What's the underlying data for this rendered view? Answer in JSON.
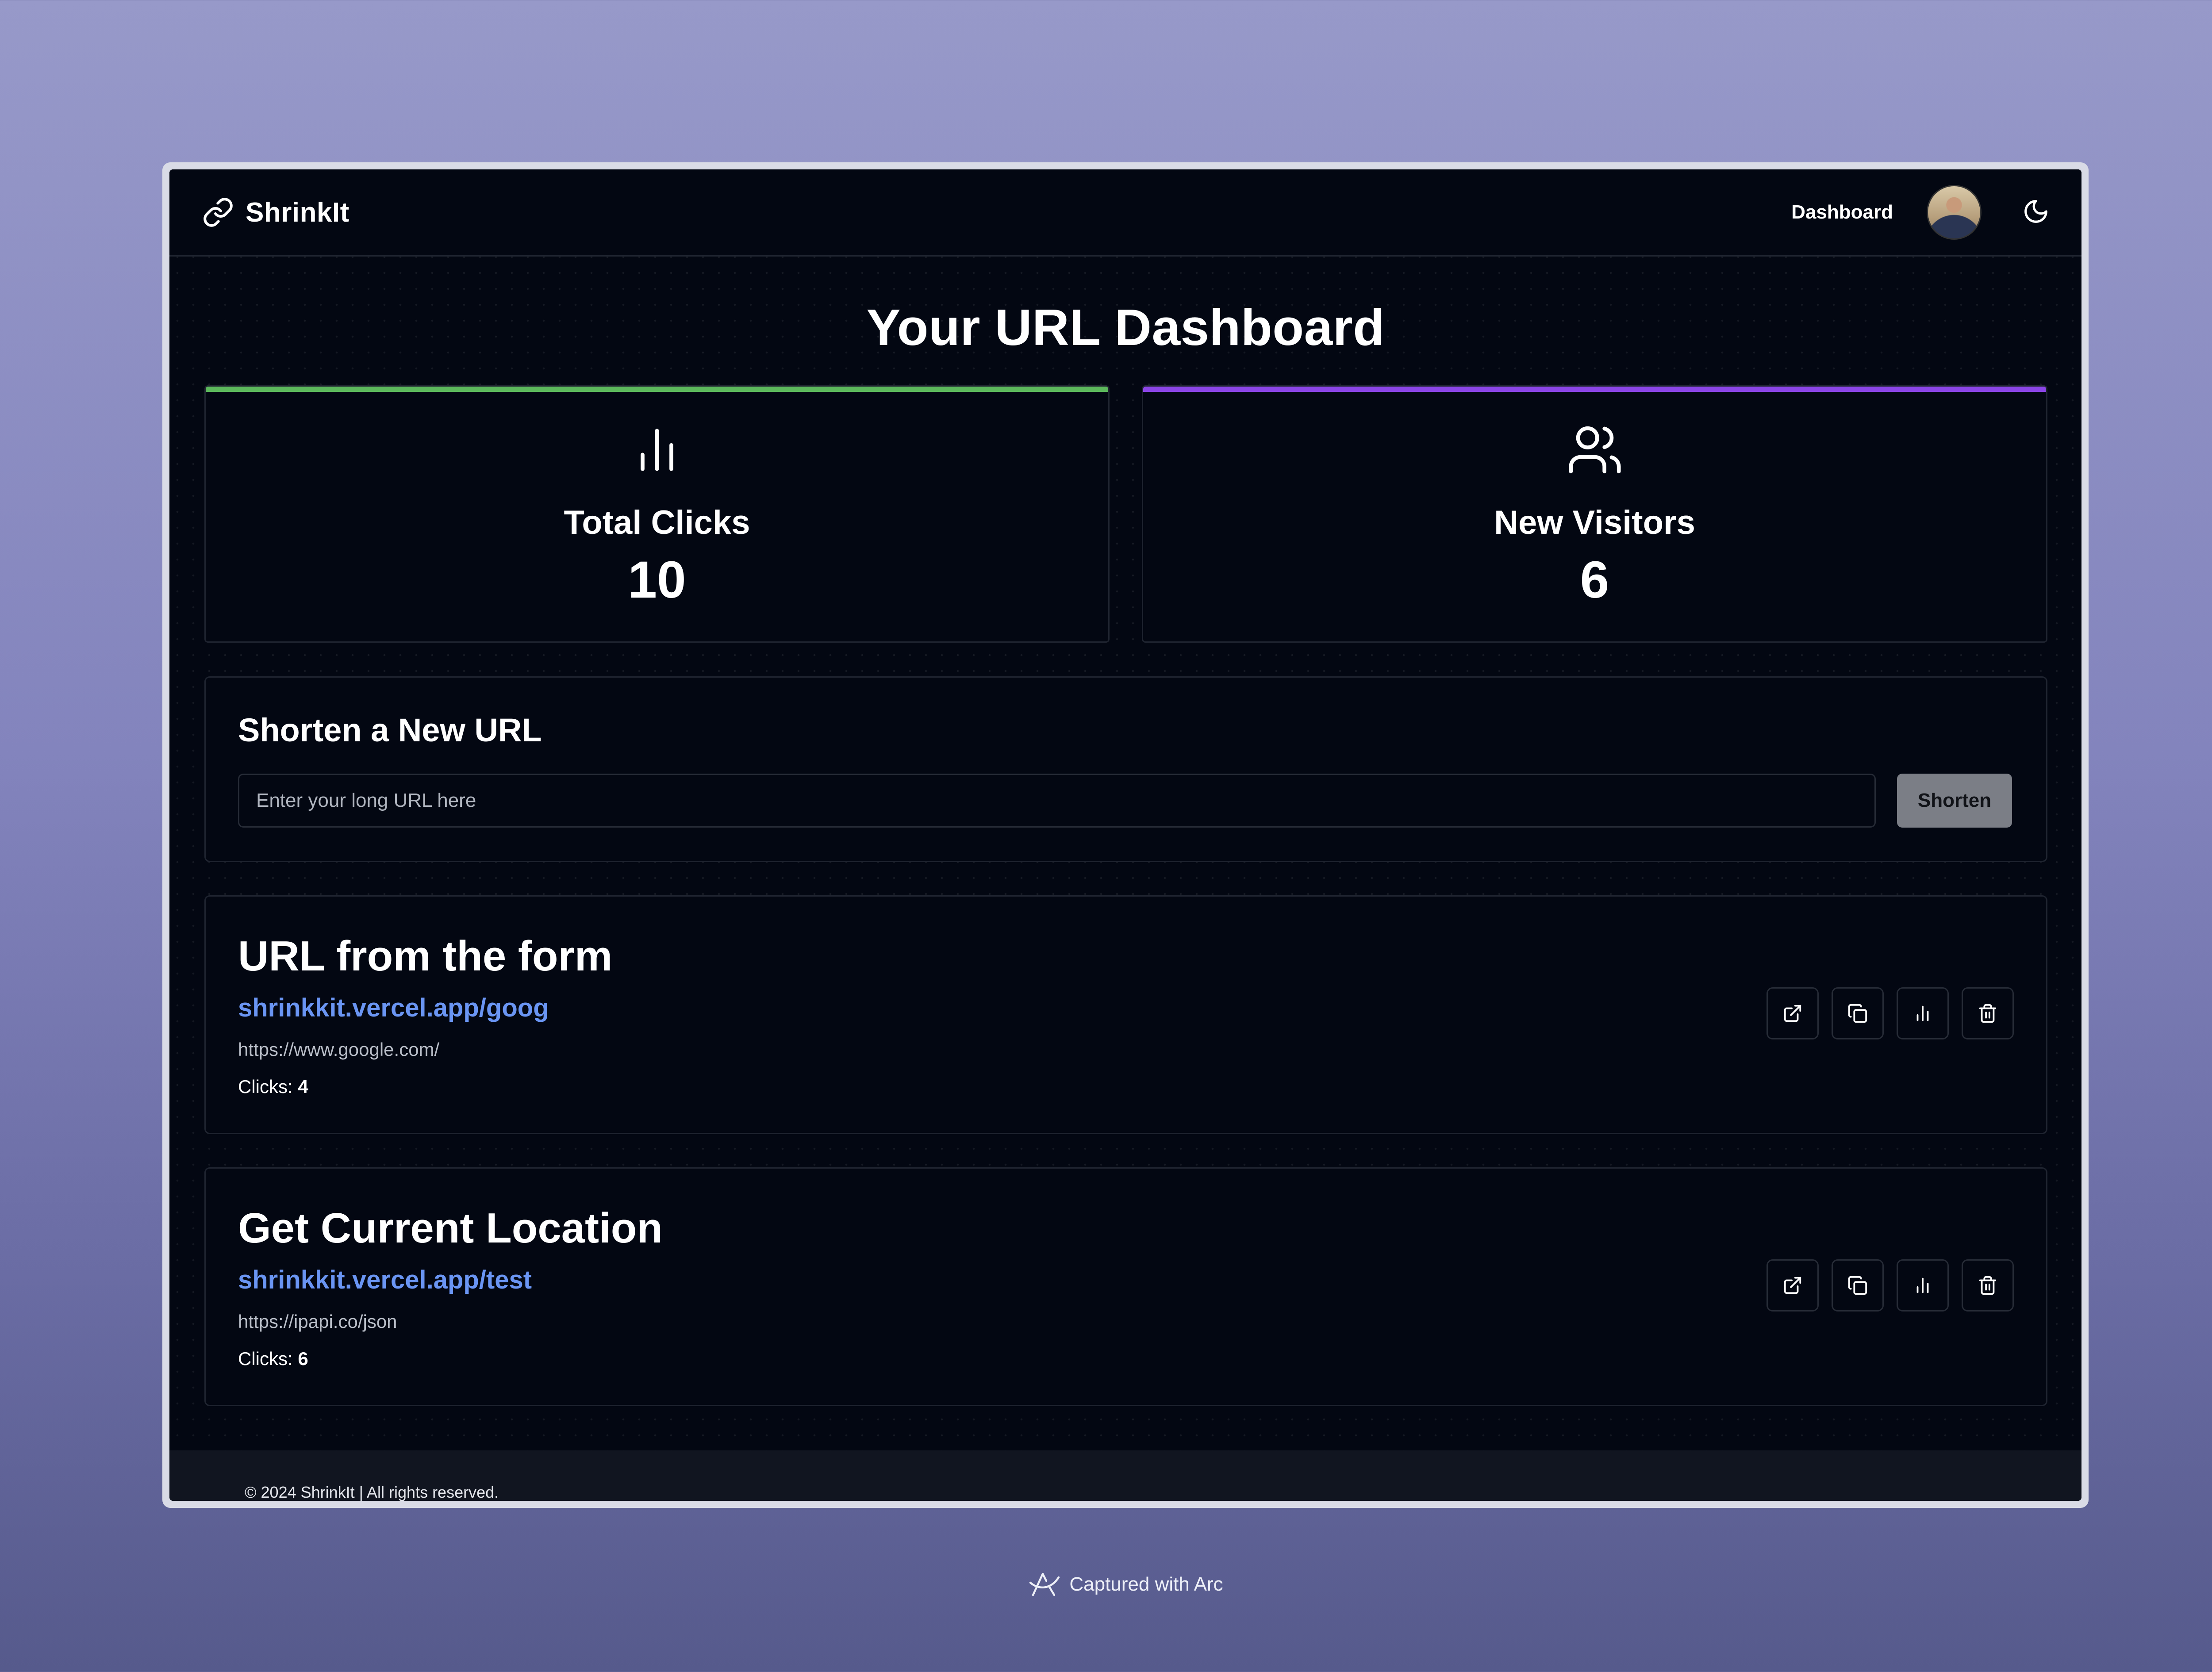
{
  "app": {
    "name": "ShrinkIt"
  },
  "nav": {
    "dashboard_label": "Dashboard"
  },
  "page": {
    "title": "Your URL Dashboard"
  },
  "stats": {
    "total_clicks": {
      "label": "Total Clicks",
      "value": "10",
      "accent": "#4caf50"
    },
    "new_visitors": {
      "label": "New Visitors",
      "value": "6",
      "accent": "#8b45e6"
    }
  },
  "shorten": {
    "title": "Shorten a New URL",
    "placeholder": "Enter your long URL here",
    "value": "",
    "button_label": "Shorten"
  },
  "urls": [
    {
      "title": "URL from the form",
      "short_url": "shrinkkit.vercel.app/goog",
      "original_url": "https://www.google.com/",
      "clicks_label": "Clicks:",
      "clicks": "4"
    },
    {
      "title": "Get Current Location",
      "short_url": "shrinkkit.vercel.app/test",
      "original_url": "https://ipapi.co/json",
      "clicks_label": "Clicks:",
      "clicks": "6"
    }
  ],
  "footer": {
    "text": "© 2024 ShrinkIt | All rights reserved."
  },
  "capture": {
    "text": "Captured with Arc"
  },
  "icons": {
    "brand": "link-icon",
    "theme": "moon-icon",
    "clicks": "bar-chart-icon",
    "visitors": "users-icon",
    "actions": [
      "external-link-icon",
      "copy-icon",
      "bar-chart-icon",
      "trash-icon"
    ]
  },
  "colors": {
    "background": "#030712",
    "link": "#6a95f3"
  }
}
